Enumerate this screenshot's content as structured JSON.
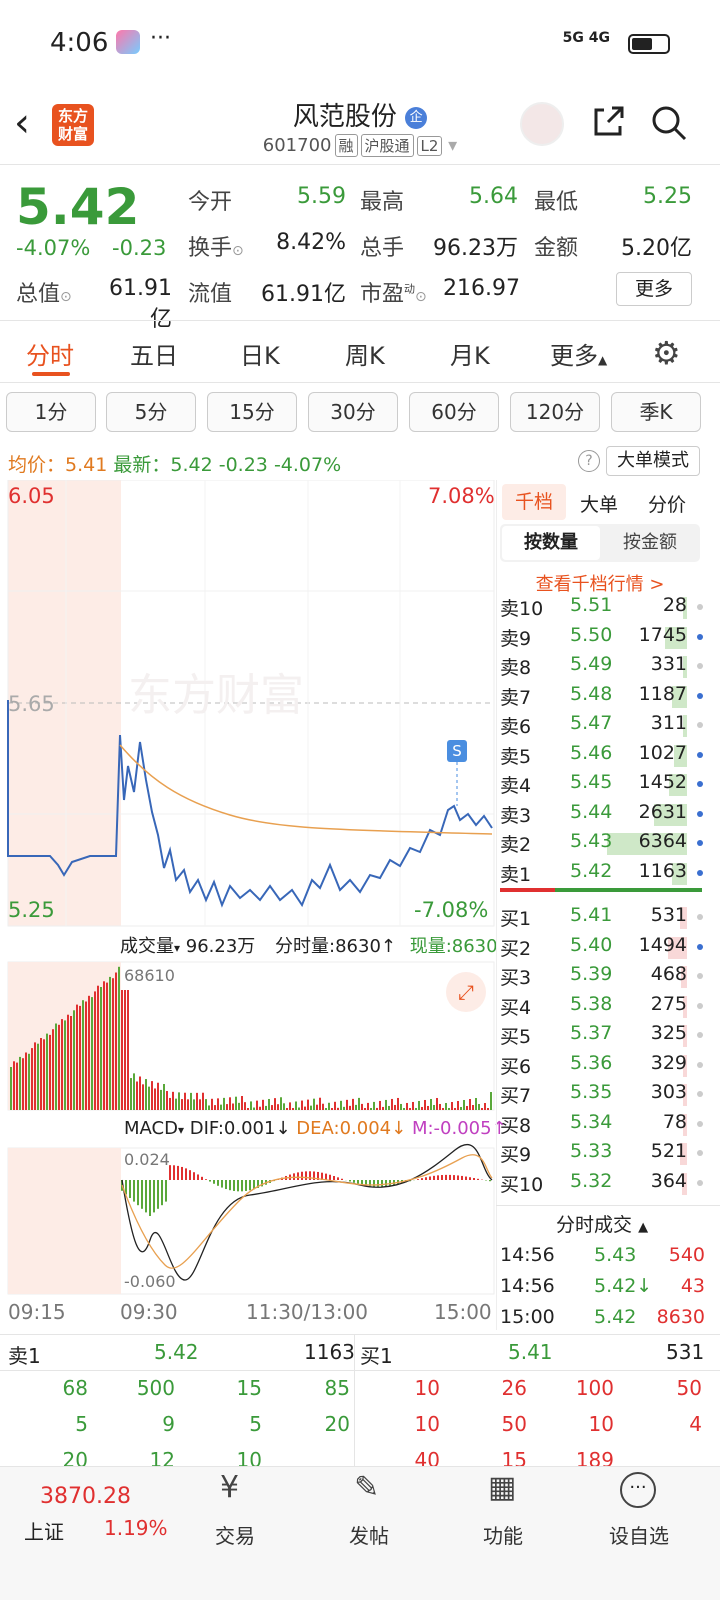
{
  "status": {
    "time": "4:06",
    "signal": "5G 4G"
  },
  "header": {
    "logo": "东方财富",
    "title": "风范股份",
    "title_badge": "企",
    "code": "601700",
    "tags": [
      "融",
      "沪股通",
      "L2"
    ]
  },
  "quote": {
    "price": "5.42",
    "pct": "-4.07%",
    "chg": "-0.23",
    "rows": [
      [
        {
          "l": "今开",
          "v": "5.59",
          "c": "green"
        },
        {
          "l": "最高",
          "v": "5.64",
          "c": "green"
        },
        {
          "l": "最低",
          "v": "5.25",
          "c": "green"
        }
      ],
      [
        {
          "l": "换手",
          "v": "8.42%",
          "c": ""
        },
        {
          "l": "总手",
          "v": "96.23万",
          "c": ""
        },
        {
          "l": "金额",
          "v": "5.20亿",
          "c": ""
        }
      ]
    ],
    "total_label": "总值",
    "total_val": "61.91亿",
    "float_label": "流值",
    "float_val": "61.91亿",
    "pe_label": "市盈",
    "pe_sup": "动",
    "pe_val": "216.97",
    "more": "更多"
  },
  "tabs": [
    "分时",
    "五日",
    "日K",
    "周K",
    "月K",
    "更多"
  ],
  "subtabs": [
    "1分",
    "5分",
    "15分",
    "30分",
    "60分",
    "120分",
    "季K"
  ],
  "infobar": {
    "avg": "均价：5.41",
    "latest": "最新：5.42",
    "chg": "-0.23",
    "pct": "-4.07%",
    "mode": "大单模式"
  },
  "chart": {
    "ytop": "6.05",
    "ymid": "5.65",
    "ybot": "5.25",
    "ptop": "7.08%",
    "pbot": "-7.08%",
    "s_marker": "S",
    "vol_label": "成交量",
    "vol_val": "96.23万",
    "vol_min": "分时量:8630",
    "vol_now": "现量:8630",
    "vol_max": "68610",
    "macd_label": "MACD",
    "dif": "DIF:0.001",
    "dea": "DEA:0.004",
    "m": "M:-0.005",
    "macd_top": "0.024",
    "macd_bot": "-0.060",
    "times": [
      "09:15",
      "09:30",
      "11:30/13:00",
      "15:00"
    ]
  },
  "chart_data": {
    "type": "line",
    "title": "",
    "x": [
      "09:15",
      "09:30",
      "11:30/13:00",
      "15:00"
    ],
    "price_range": [
      5.25,
      6.05
    ],
    "prev_close": 5.65,
    "latest": 5.42,
    "avg": 5.41,
    "volume_max": 68610
  },
  "orderbook": {
    "tabs": [
      "千档",
      "大单",
      "分价"
    ],
    "modes": [
      "按数量",
      "按金额"
    ],
    "link": "查看千档行情 >",
    "asks": [
      [
        "卖10",
        "5.51",
        "28"
      ],
      [
        "卖9",
        "5.50",
        "1745"
      ],
      [
        "卖8",
        "5.49",
        "331"
      ],
      [
        "卖7",
        "5.48",
        "1187"
      ],
      [
        "卖6",
        "5.47",
        "311"
      ],
      [
        "卖5",
        "5.46",
        "1027"
      ],
      [
        "卖4",
        "5.45",
        "1452"
      ],
      [
        "卖3",
        "5.44",
        "2631"
      ],
      [
        "卖2",
        "5.43",
        "6364"
      ],
      [
        "卖1",
        "5.42",
        "1163"
      ]
    ],
    "bids": [
      [
        "买1",
        "5.41",
        "531"
      ],
      [
        "买2",
        "5.40",
        "1494"
      ],
      [
        "买3",
        "5.39",
        "468"
      ],
      [
        "买4",
        "5.38",
        "275"
      ],
      [
        "买5",
        "5.37",
        "325"
      ],
      [
        "买6",
        "5.36",
        "329"
      ],
      [
        "买7",
        "5.35",
        "303"
      ],
      [
        "买8",
        "5.34",
        "78"
      ],
      [
        "买9",
        "5.33",
        "521"
      ],
      [
        "买10",
        "5.32",
        "364"
      ]
    ],
    "ticks_title": "分时成交",
    "ticks": [
      [
        "14:56",
        "5.43",
        "540"
      ],
      [
        "14:56",
        "5.42↓",
        "43"
      ],
      [
        "15:00",
        "5.42",
        "8630"
      ]
    ]
  },
  "bottom": {
    "s1": "卖1",
    "s1p": "5.42",
    "s1v": "1163",
    "b1": "买1",
    "b1p": "5.41",
    "b1v": "531",
    "left": [
      [
        "68",
        "500",
        "15",
        "85"
      ],
      [
        "5",
        "9",
        "5",
        "20"
      ],
      [
        "20",
        "12",
        "10",
        ""
      ]
    ],
    "right": [
      [
        "10",
        "26",
        "100",
        "50"
      ],
      [
        "10",
        "50",
        "10",
        "4"
      ],
      [
        "40",
        "15",
        "189",
        ""
      ]
    ]
  },
  "nav": {
    "index_val": "3870.28",
    "index_name": "上证",
    "index_pct": "1.19%",
    "items": [
      "交易",
      "发帖",
      "功能",
      "设自选"
    ]
  }
}
